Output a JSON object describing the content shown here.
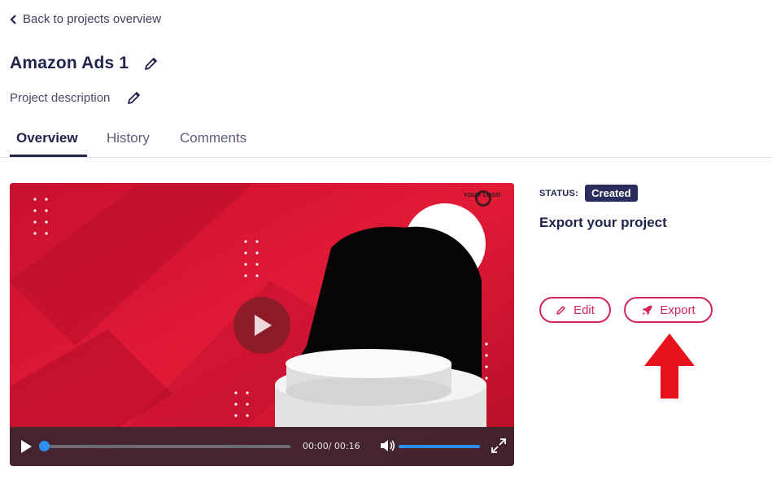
{
  "nav": {
    "back_label": "Back to projects overview"
  },
  "project": {
    "title": "Amazon Ads 1",
    "description": "Project description"
  },
  "tabs": [
    {
      "label": "Overview",
      "active": true
    },
    {
      "label": "History",
      "active": false
    },
    {
      "label": "Comments",
      "active": false
    }
  ],
  "video": {
    "logo_text": "YOUR LOGO",
    "time": "00:00/ 00:16",
    "progress": 0,
    "volume": 1.0
  },
  "sidebar": {
    "status_label": "STATUS:",
    "status_value": "Created",
    "heading": "Export your project",
    "edit_label": "Edit",
    "export_label": "Export"
  },
  "colors": {
    "accent": "#d2255a",
    "navy": "#22254b",
    "badge": "#2a2d5c",
    "video_red": "#d2112f",
    "player_blue": "#2d8ff0",
    "arrow_red": "#e8121b"
  },
  "icons": [
    "chevron-left-icon",
    "pencil-icon",
    "play-icon",
    "volume-icon",
    "fullscreen-icon",
    "rocket-icon",
    "arrow-up-icon"
  ]
}
